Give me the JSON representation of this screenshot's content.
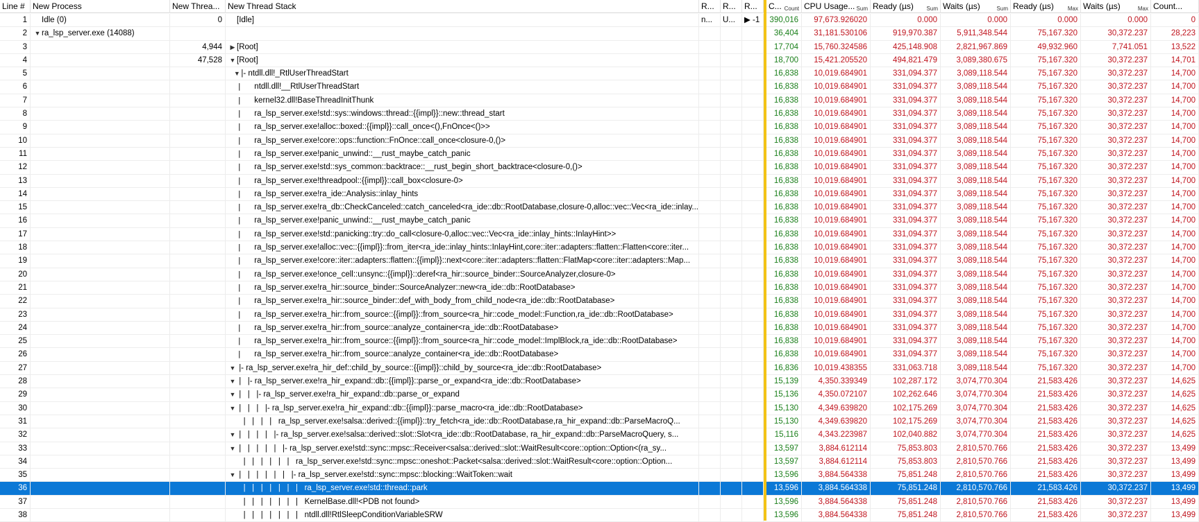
{
  "columns": {
    "line": "Line #",
    "process": "New Process",
    "thread": "New Threa...",
    "stack": "New Thread Stack",
    "r1": "R...",
    "r2": "R...",
    "r3": "R...",
    "count": "C...",
    "count_sub": "Count",
    "cpu": "CPU Usage...",
    "cpu_sub": "Sum",
    "ready": "Ready (µs)",
    "ready_sub": "Sum",
    "waits": "Waits (µs)",
    "waits_sub": "Sum",
    "ready_max": "Ready (µs)",
    "ready_max_sub": "Max",
    "waits_max": "Waits (µs)",
    "waits_max_sub": "Max",
    "count2": "Count..."
  },
  "rows": [
    {
      "line": "1",
      "proc": "Idle (0)",
      "proc_tw": "",
      "thread": "0",
      "stack_prefix": "",
      "stack_tw": "",
      "stack": "[Idle]",
      "r1": "n...",
      "r2": "U...",
      "r3": "▶ -1",
      "cnt": "390,016",
      "cpu": "97,673.926020",
      "rdy": "0.000",
      "wt": "0.000",
      "rdymax": "0.000",
      "wtmax": "0.000",
      "cnt2": "0"
    },
    {
      "line": "2",
      "proc": "ra_lsp_server.exe (14088)",
      "proc_tw": "▼",
      "thread": "",
      "stack_prefix": "",
      "stack_tw": "",
      "stack": "",
      "r1": "",
      "r2": "",
      "r3": "",
      "cnt": "36,404",
      "cpu": "31,181.530106",
      "rdy": "919,970.387",
      "wt": "5,911,348.544",
      "rdymax": "75,167.320",
      "wtmax": "30,372.237",
      "cnt2": "28,223"
    },
    {
      "line": "3",
      "proc": "",
      "proc_tw": "",
      "thread": "4,944",
      "stack_prefix": "",
      "stack_tw": "▶",
      "stack": "[Root]",
      "r1": "",
      "r2": "",
      "r3": "",
      "cnt": "17,704",
      "cpu": "15,760.324586",
      "rdy": "425,148.908",
      "wt": "2,821,967.869",
      "rdymax": "49,932.960",
      "wtmax": "7,741.051",
      "cnt2": "13,522"
    },
    {
      "line": "4",
      "proc": "",
      "proc_tw": "",
      "thread": "47,528",
      "stack_prefix": "",
      "stack_tw": "▼",
      "stack": "[Root]",
      "r1": "",
      "r2": "",
      "r3": "",
      "cnt": "18,700",
      "cpu": "15,421.205520",
      "rdy": "494,821.479",
      "wt": "3,089,380.675",
      "rdymax": "75,167.320",
      "wtmax": "30,372.237",
      "cnt2": "14,701"
    },
    {
      "line": "5",
      "proc": "",
      "proc_tw": "",
      "thread": "",
      "stack_prefix": " ",
      "stack_tw": "▼",
      "stack": "|- ntdll.dll!_RtlUserThreadStart",
      "r1": "",
      "r2": "",
      "r3": "",
      "cnt": "16,838",
      "cpu": "10,019.684901",
      "rdy": "331,094.377",
      "wt": "3,089,118.544",
      "rdymax": "75,167.320",
      "wtmax": "30,372.237",
      "cnt2": "14,700"
    },
    {
      "line": "6",
      "proc": "",
      "proc_tw": "",
      "thread": "",
      "stack_prefix": "  | ",
      "stack_tw": "",
      "stack": "ntdll.dll!__RtlUserThreadStart",
      "r1": "",
      "r2": "",
      "r3": "",
      "cnt": "16,838",
      "cpu": "10,019.684901",
      "rdy": "331,094.377",
      "wt": "3,089,118.544",
      "rdymax": "75,167.320",
      "wtmax": "30,372.237",
      "cnt2": "14,700"
    },
    {
      "line": "7",
      "proc": "",
      "proc_tw": "",
      "thread": "",
      "stack_prefix": "  | ",
      "stack_tw": "",
      "stack": "kernel32.dll!BaseThreadInitThunk",
      "r1": "",
      "r2": "",
      "r3": "",
      "cnt": "16,838",
      "cpu": "10,019.684901",
      "rdy": "331,094.377",
      "wt": "3,089,118.544",
      "rdymax": "75,167.320",
      "wtmax": "30,372.237",
      "cnt2": "14,700"
    },
    {
      "line": "8",
      "proc": "",
      "proc_tw": "",
      "thread": "",
      "stack_prefix": "  | ",
      "stack_tw": "",
      "stack": "ra_lsp_server.exe!std::sys::windows::thread::{{impl}}::new::thread_start",
      "r1": "",
      "r2": "",
      "r3": "",
      "cnt": "16,838",
      "cpu": "10,019.684901",
      "rdy": "331,094.377",
      "wt": "3,089,118.544",
      "rdymax": "75,167.320",
      "wtmax": "30,372.237",
      "cnt2": "14,700"
    },
    {
      "line": "9",
      "proc": "",
      "proc_tw": "",
      "thread": "",
      "stack_prefix": "  | ",
      "stack_tw": "",
      "stack": "ra_lsp_server.exe!alloc::boxed::{{impl}}::call_once<(),FnOnce<()>>",
      "r1": "",
      "r2": "",
      "r3": "",
      "cnt": "16,838",
      "cpu": "10,019.684901",
      "rdy": "331,094.377",
      "wt": "3,089,118.544",
      "rdymax": "75,167.320",
      "wtmax": "30,372.237",
      "cnt2": "14,700"
    },
    {
      "line": "10",
      "proc": "",
      "proc_tw": "",
      "thread": "",
      "stack_prefix": "  | ",
      "stack_tw": "",
      "stack": "ra_lsp_server.exe!core::ops::function::FnOnce::call_once<closure-0,()>",
      "r1": "",
      "r2": "",
      "r3": "",
      "cnt": "16,838",
      "cpu": "10,019.684901",
      "rdy": "331,094.377",
      "wt": "3,089,118.544",
      "rdymax": "75,167.320",
      "wtmax": "30,372.237",
      "cnt2": "14,700"
    },
    {
      "line": "11",
      "proc": "",
      "proc_tw": "",
      "thread": "",
      "stack_prefix": "  | ",
      "stack_tw": "",
      "stack": "ra_lsp_server.exe!panic_unwind::__rust_maybe_catch_panic",
      "r1": "",
      "r2": "",
      "r3": "",
      "cnt": "16,838",
      "cpu": "10,019.684901",
      "rdy": "331,094.377",
      "wt": "3,089,118.544",
      "rdymax": "75,167.320",
      "wtmax": "30,372.237",
      "cnt2": "14,700"
    },
    {
      "line": "12",
      "proc": "",
      "proc_tw": "",
      "thread": "",
      "stack_prefix": "  | ",
      "stack_tw": "",
      "stack": "ra_lsp_server.exe!std::sys_common::backtrace::__rust_begin_short_backtrace<closure-0,()>",
      "r1": "",
      "r2": "",
      "r3": "",
      "cnt": "16,838",
      "cpu": "10,019.684901",
      "rdy": "331,094.377",
      "wt": "3,089,118.544",
      "rdymax": "75,167.320",
      "wtmax": "30,372.237",
      "cnt2": "14,700"
    },
    {
      "line": "13",
      "proc": "",
      "proc_tw": "",
      "thread": "",
      "stack_prefix": "  | ",
      "stack_tw": "",
      "stack": "ra_lsp_server.exe!threadpool::{{impl}}::call_box<closure-0>",
      "r1": "",
      "r2": "",
      "r3": "",
      "cnt": "16,838",
      "cpu": "10,019.684901",
      "rdy": "331,094.377",
      "wt": "3,089,118.544",
      "rdymax": "75,167.320",
      "wtmax": "30,372.237",
      "cnt2": "14,700"
    },
    {
      "line": "14",
      "proc": "",
      "proc_tw": "",
      "thread": "",
      "stack_prefix": "  | ",
      "stack_tw": "",
      "stack": "ra_lsp_server.exe!ra_ide::Analysis::inlay_hints",
      "r1": "",
      "r2": "",
      "r3": "",
      "cnt": "16,838",
      "cpu": "10,019.684901",
      "rdy": "331,094.377",
      "wt": "3,089,118.544",
      "rdymax": "75,167.320",
      "wtmax": "30,372.237",
      "cnt2": "14,700"
    },
    {
      "line": "15",
      "proc": "",
      "proc_tw": "",
      "thread": "",
      "stack_prefix": "  | ",
      "stack_tw": "",
      "stack": "ra_lsp_server.exe!ra_db::CheckCanceled::catch_canceled<ra_ide::db::RootDatabase,closure-0,alloc::vec::Vec<ra_ide::inlay...",
      "r1": "",
      "r2": "",
      "r3": "",
      "cnt": "16,838",
      "cpu": "10,019.684901",
      "rdy": "331,094.377",
      "wt": "3,089,118.544",
      "rdymax": "75,167.320",
      "wtmax": "30,372.237",
      "cnt2": "14,700"
    },
    {
      "line": "16",
      "proc": "",
      "proc_tw": "",
      "thread": "",
      "stack_prefix": "  | ",
      "stack_tw": "",
      "stack": "ra_lsp_server.exe!panic_unwind::__rust_maybe_catch_panic",
      "r1": "",
      "r2": "",
      "r3": "",
      "cnt": "16,838",
      "cpu": "10,019.684901",
      "rdy": "331,094.377",
      "wt": "3,089,118.544",
      "rdymax": "75,167.320",
      "wtmax": "30,372.237",
      "cnt2": "14,700"
    },
    {
      "line": "17",
      "proc": "",
      "proc_tw": "",
      "thread": "",
      "stack_prefix": "  | ",
      "stack_tw": "",
      "stack": "ra_lsp_server.exe!std::panicking::try::do_call<closure-0,alloc::vec::Vec<ra_ide::inlay_hints::InlayHint>>",
      "r1": "",
      "r2": "",
      "r3": "",
      "cnt": "16,838",
      "cpu": "10,019.684901",
      "rdy": "331,094.377",
      "wt": "3,089,118.544",
      "rdymax": "75,167.320",
      "wtmax": "30,372.237",
      "cnt2": "14,700"
    },
    {
      "line": "18",
      "proc": "",
      "proc_tw": "",
      "thread": "",
      "stack_prefix": "  | ",
      "stack_tw": "",
      "stack": "ra_lsp_server.exe!alloc::vec::{{impl}}::from_iter<ra_ide::inlay_hints::InlayHint,core::iter::adapters::flatten::Flatten<core::iter...",
      "r1": "",
      "r2": "",
      "r3": "",
      "cnt": "16,838",
      "cpu": "10,019.684901",
      "rdy": "331,094.377",
      "wt": "3,089,118.544",
      "rdymax": "75,167.320",
      "wtmax": "30,372.237",
      "cnt2": "14,700"
    },
    {
      "line": "19",
      "proc": "",
      "proc_tw": "",
      "thread": "",
      "stack_prefix": "  | ",
      "stack_tw": "",
      "stack": "ra_lsp_server.exe!core::iter::adapters::flatten::{{impl}}::next<core::iter::adapters::flatten::FlatMap<core::iter::adapters::Map...",
      "r1": "",
      "r2": "",
      "r3": "",
      "cnt": "16,838",
      "cpu": "10,019.684901",
      "rdy": "331,094.377",
      "wt": "3,089,118.544",
      "rdymax": "75,167.320",
      "wtmax": "30,372.237",
      "cnt2": "14,700"
    },
    {
      "line": "20",
      "proc": "",
      "proc_tw": "",
      "thread": "",
      "stack_prefix": "  | ",
      "stack_tw": "",
      "stack": "ra_lsp_server.exe!once_cell::unsync::{{impl}}::deref<ra_hir::source_binder::SourceAnalyzer,closure-0>",
      "r1": "",
      "r2": "",
      "r3": "",
      "cnt": "16,838",
      "cpu": "10,019.684901",
      "rdy": "331,094.377",
      "wt": "3,089,118.544",
      "rdymax": "75,167.320",
      "wtmax": "30,372.237",
      "cnt2": "14,700"
    },
    {
      "line": "21",
      "proc": "",
      "proc_tw": "",
      "thread": "",
      "stack_prefix": "  | ",
      "stack_tw": "",
      "stack": "ra_lsp_server.exe!ra_hir::source_binder::SourceAnalyzer::new<ra_ide::db::RootDatabase>",
      "r1": "",
      "r2": "",
      "r3": "",
      "cnt": "16,838",
      "cpu": "10,019.684901",
      "rdy": "331,094.377",
      "wt": "3,089,118.544",
      "rdymax": "75,167.320",
      "wtmax": "30,372.237",
      "cnt2": "14,700"
    },
    {
      "line": "22",
      "proc": "",
      "proc_tw": "",
      "thread": "",
      "stack_prefix": "  | ",
      "stack_tw": "",
      "stack": "ra_lsp_server.exe!ra_hir::source_binder::def_with_body_from_child_node<ra_ide::db::RootDatabase>",
      "r1": "",
      "r2": "",
      "r3": "",
      "cnt": "16,838",
      "cpu": "10,019.684901",
      "rdy": "331,094.377",
      "wt": "3,089,118.544",
      "rdymax": "75,167.320",
      "wtmax": "30,372.237",
      "cnt2": "14,700"
    },
    {
      "line": "23",
      "proc": "",
      "proc_tw": "",
      "thread": "",
      "stack_prefix": "  | ",
      "stack_tw": "",
      "stack": "ra_lsp_server.exe!ra_hir::from_source::{{impl}}::from_source<ra_hir::code_model::Function,ra_ide::db::RootDatabase>",
      "r1": "",
      "r2": "",
      "r3": "",
      "cnt": "16,838",
      "cpu": "10,019.684901",
      "rdy": "331,094.377",
      "wt": "3,089,118.544",
      "rdymax": "75,167.320",
      "wtmax": "30,372.237",
      "cnt2": "14,700"
    },
    {
      "line": "24",
      "proc": "",
      "proc_tw": "",
      "thread": "",
      "stack_prefix": "  | ",
      "stack_tw": "",
      "stack": "ra_lsp_server.exe!ra_hir::from_source::analyze_container<ra_ide::db::RootDatabase>",
      "r1": "",
      "r2": "",
      "r3": "",
      "cnt": "16,838",
      "cpu": "10,019.684901",
      "rdy": "331,094.377",
      "wt": "3,089,118.544",
      "rdymax": "75,167.320",
      "wtmax": "30,372.237",
      "cnt2": "14,700"
    },
    {
      "line": "25",
      "proc": "",
      "proc_tw": "",
      "thread": "",
      "stack_prefix": "  | ",
      "stack_tw": "",
      "stack": "ra_lsp_server.exe!ra_hir::from_source::{{impl}}::from_source<ra_hir::code_model::ImplBlock,ra_ide::db::RootDatabase>",
      "r1": "",
      "r2": "",
      "r3": "",
      "cnt": "16,838",
      "cpu": "10,019.684901",
      "rdy": "331,094.377",
      "wt": "3,089,118.544",
      "rdymax": "75,167.320",
      "wtmax": "30,372.237",
      "cnt2": "14,700"
    },
    {
      "line": "26",
      "proc": "",
      "proc_tw": "",
      "thread": "",
      "stack_prefix": "  | ",
      "stack_tw": "",
      "stack": "ra_lsp_server.exe!ra_hir::from_source::analyze_container<ra_ide::db::RootDatabase>",
      "r1": "",
      "r2": "",
      "r3": "",
      "cnt": "16,838",
      "cpu": "10,019.684901",
      "rdy": "331,094.377",
      "wt": "3,089,118.544",
      "rdymax": "75,167.320",
      "wtmax": "30,372.237",
      "cnt2": "14,700"
    },
    {
      "line": "27",
      "proc": "",
      "proc_tw": "",
      "thread": "",
      "stack_prefix": "",
      "stack_tw": "▼",
      "stack": " |- ra_lsp_server.exe!ra_hir_def::child_by_source::{{impl}}::child_by_source<ra_ide::db::RootDatabase>",
      "r1": "",
      "r2": "",
      "r3": "",
      "cnt": "16,836",
      "cpu": "10,019.438355",
      "rdy": "331,063.718",
      "wt": "3,089,118.544",
      "rdymax": "75,167.320",
      "wtmax": "30,372.237",
      "cnt2": "14,700"
    },
    {
      "line": "28",
      "proc": "",
      "proc_tw": "",
      "thread": "",
      "stack_prefix": "",
      "stack_tw": "▼",
      "stack": " |   |- ra_lsp_server.exe!ra_hir_expand::db::{{impl}}::parse_or_expand<ra_ide::db::RootDatabase>",
      "r1": "",
      "r2": "",
      "r3": "",
      "cnt": "15,139",
      "cpu": "4,350.339349",
      "rdy": "102,287.172",
      "wt": "3,074,770.304",
      "rdymax": "21,583.426",
      "wtmax": "30,372.237",
      "cnt2": "14,625"
    },
    {
      "line": "29",
      "proc": "",
      "proc_tw": "",
      "thread": "",
      "stack_prefix": "",
      "stack_tw": "▼",
      "stack": " |   |   |- ra_lsp_server.exe!ra_hir_expand::db::parse_or_expand",
      "r1": "",
      "r2": "",
      "r3": "",
      "cnt": "15,136",
      "cpu": "4,350.072107",
      "rdy": "102,262.646",
      "wt": "3,074,770.304",
      "rdymax": "21,583.426",
      "wtmax": "30,372.237",
      "cnt2": "14,625"
    },
    {
      "line": "30",
      "proc": "",
      "proc_tw": "",
      "thread": "",
      "stack_prefix": "",
      "stack_tw": "▼",
      "stack": " |   |   |   |- ra_lsp_server.exe!ra_hir_expand::db::{{impl}}::parse_macro<ra_ide::db::RootDatabase>",
      "r1": "",
      "r2": "",
      "r3": "",
      "cnt": "15,130",
      "cpu": "4,349.639820",
      "rdy": "102,175.269",
      "wt": "3,074,770.304",
      "rdymax": "21,583.426",
      "wtmax": "30,372.237",
      "cnt2": "14,625"
    },
    {
      "line": "31",
      "proc": "",
      "proc_tw": "",
      "thread": "",
      "stack_prefix": "",
      "stack_tw": "",
      "stack": "   |   |   |   |   ra_lsp_server.exe!salsa::derived::{{impl}}::try_fetch<ra_ide::db::RootDatabase,ra_hir_expand::db::ParseMacroQ...",
      "r1": "",
      "r2": "",
      "r3": "",
      "cnt": "15,130",
      "cpu": "4,349.639820",
      "rdy": "102,175.269",
      "wt": "3,074,770.304",
      "rdymax": "21,583.426",
      "wtmax": "30,372.237",
      "cnt2": "14,625"
    },
    {
      "line": "32",
      "proc": "",
      "proc_tw": "",
      "thread": "",
      "stack_prefix": "",
      "stack_tw": "▼",
      "stack": " |   |   |   |   |- ra_lsp_server.exe!salsa::derived::slot::Slot<ra_ide::db::RootDatabase, ra_hir_expand::db::ParseMacroQuery, s...",
      "r1": "",
      "r2": "",
      "r3": "",
      "cnt": "15,116",
      "cpu": "4,343.223987",
      "rdy": "102,040.882",
      "wt": "3,074,770.304",
      "rdymax": "21,583.426",
      "wtmax": "30,372.237",
      "cnt2": "14,625"
    },
    {
      "line": "33",
      "proc": "",
      "proc_tw": "",
      "thread": "",
      "stack_prefix": "",
      "stack_tw": "▼",
      "stack": " |   |   |   |   |   |- ra_lsp_server.exe!std::sync::mpsc::Receiver<salsa::derived::slot::WaitResult<core::option::Option<(ra_sy...",
      "r1": "",
      "r2": "",
      "r3": "",
      "cnt": "13,597",
      "cpu": "3,884.612114",
      "rdy": "75,853.803",
      "wt": "2,810,570.766",
      "rdymax": "21,583.426",
      "wtmax": "30,372.237",
      "cnt2": "13,499"
    },
    {
      "line": "34",
      "proc": "",
      "proc_tw": "",
      "thread": "",
      "stack_prefix": "",
      "stack_tw": "",
      "stack": "   |   |   |   |   |   |   ra_lsp_server.exe!std::sync::mpsc::oneshot::Packet<salsa::derived::slot::WaitResult<core::option::Option...",
      "r1": "",
      "r2": "",
      "r3": "",
      "cnt": "13,597",
      "cpu": "3,884.612114",
      "rdy": "75,853.803",
      "wt": "2,810,570.766",
      "rdymax": "21,583.426",
      "wtmax": "30,372.237",
      "cnt2": "13,499"
    },
    {
      "line": "35",
      "proc": "",
      "proc_tw": "",
      "thread": "",
      "stack_prefix": "",
      "stack_tw": "▼",
      "stack": " |   |   |   |   |   |   |- ra_lsp_server.exe!std::sync::mpsc::blocking::WaitToken::wait",
      "r1": "",
      "r2": "",
      "r3": "",
      "cnt": "13,596",
      "cpu": "3,884.564338",
      "rdy": "75,851.248",
      "wt": "2,810,570.766",
      "rdymax": "21,583.426",
      "wtmax": "30,372.237",
      "cnt2": "13,499"
    },
    {
      "line": "36",
      "proc": "",
      "proc_tw": "",
      "thread": "",
      "stack_prefix": "",
      "stack_tw": "",
      "stack": "   |   |   |   |   |   |   |   ra_lsp_server.exe!std::thread::park",
      "r1": "",
      "r2": "",
      "r3": "",
      "cnt": "13,596",
      "cpu": "3,884.564338",
      "rdy": "75,851.248",
      "wt": "2,810,570.766",
      "rdymax": "21,583.426",
      "wtmax": "30,372.237",
      "cnt2": "13,499",
      "selected": true
    },
    {
      "line": "37",
      "proc": "",
      "proc_tw": "",
      "thread": "",
      "stack_prefix": "",
      "stack_tw": "",
      "stack": "   |   |   |   |   |   |   |   KernelBase.dll!<PDB not found>",
      "r1": "",
      "r2": "",
      "r3": "",
      "cnt": "13,596",
      "cpu": "3,884.564338",
      "rdy": "75,851.248",
      "wt": "2,810,570.766",
      "rdymax": "21,583.426",
      "wtmax": "30,372.237",
      "cnt2": "13,499"
    },
    {
      "line": "38",
      "proc": "",
      "proc_tw": "",
      "thread": "",
      "stack_prefix": "",
      "stack_tw": "",
      "stack": "   |   |   |   |   |   |   |   ntdll.dll!RtlSleepConditionVariableSRW",
      "r1": "",
      "r2": "",
      "r3": "",
      "cnt": "13,596",
      "cpu": "3,884.564338",
      "rdy": "75,851.248",
      "wt": "2,810,570.766",
      "rdymax": "21,583.426",
      "wtmax": "30,372.237",
      "cnt2": "13,499"
    }
  ],
  "colors": {
    "selection": "#0b78d6",
    "separator": "#f3c316",
    "count_text": "#1a7f1a",
    "value_text": "#c0141e"
  }
}
